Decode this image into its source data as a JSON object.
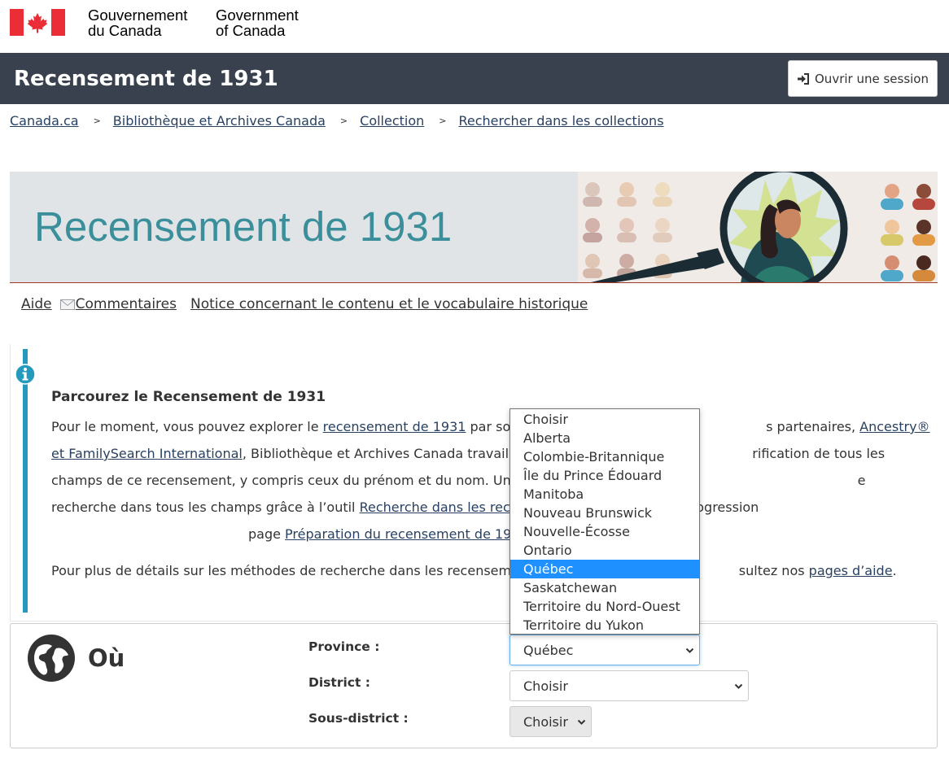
{
  "gov": {
    "fr_line1": "Gouvernement",
    "fr_line2": "du Canada",
    "en_line1": "Government",
    "en_line2": "of Canada"
  },
  "app": {
    "title": "Recensement de 1931",
    "signin_label": "Ouvrir une session"
  },
  "breadcrumb": {
    "items": [
      "Canada.ca",
      "Bibliothèque et Archives Canada",
      "Collection",
      "Rechercher dans les collections"
    ],
    "separator": ">"
  },
  "banner": {
    "title": "Recensement de 1931"
  },
  "links": {
    "help": "Aide",
    "comments": "Commentaires",
    "notice": "Notice concernant le contenu et le vocabulaire historique"
  },
  "alert": {
    "heading": "Parcourez le Recensement de 1931",
    "p1_a": "Pour le moment, vous pouvez explorer le ",
    "p1_link1": "recensement de 1931",
    "p1_b": " par sous-di",
    "p1_c": "s partenaires, ",
    "p1_link2": "Ancestry® et FamilySearch International",
    "p1_d": ", Bibliothèque et Archives Canada travaille actue",
    "p1_e": "rification de tous les champs de ce recensement, y compris ceux du prénom et du nom. Une fois ce travail term",
    "p1_f": "e recherche dans tous les champs grâce à l’outil ",
    "p1_link3": "Recherche dans les recensements",
    "p1_g": ". Pour suivre la progression",
    "p1_h": "page ",
    "p1_link4": "Préparation du recensement de 1931",
    "p1_i": ".",
    "p2_a": "Pour plus de détails sur les méthodes de recherche dans les recensements,",
    "p2_b": "sultez nos ",
    "p2_link": "pages d’aide",
    "p2_c": "."
  },
  "where": {
    "title": "Où",
    "province_label": "Province :",
    "district_label": "District :",
    "subdistrict_label": "Sous-district :",
    "province_value": "Québec",
    "district_value": "Choisir",
    "subdistrict_value": "Choisir"
  },
  "province_options": [
    "Choisir",
    "Alberta",
    "Colombie-Britannique",
    "Île du Prince Édouard",
    "Manitoba",
    "Nouveau Brunswick",
    "Nouvelle-Écosse",
    "Ontario",
    "Québec",
    "Saskatchewan",
    "Territoire du Nord-Ouest",
    "Territoire du Yukon"
  ],
  "province_selected": "Québec",
  "colors": {
    "app_bar": "#38414d",
    "banner_title": "#3a8f9a",
    "alert_accent": "#269abc",
    "link": "#284162",
    "visited_link": "#7834bc",
    "selected_option": "#1e90ff",
    "flag_red": "#eb2d37"
  },
  "icons": [
    "canada-flag-icon",
    "sign-in-icon",
    "mail-icon",
    "info-icon",
    "globe-icon",
    "chevron-down-icon"
  ]
}
